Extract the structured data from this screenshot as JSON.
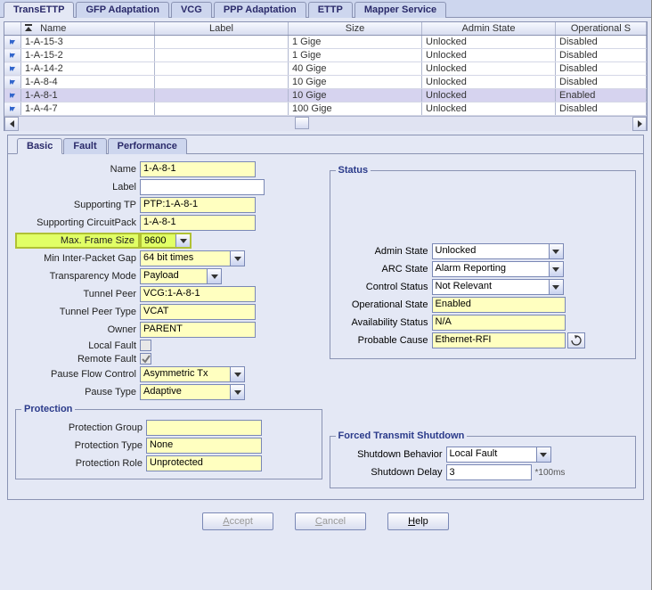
{
  "main_tabs": [
    "TransETTP",
    "GFP Adaptation",
    "VCG",
    "PPP Adaptation",
    "ETTP",
    "Mapper Service"
  ],
  "main_tab_active": 0,
  "table": {
    "cols": [
      "",
      "Name",
      "Label",
      "Size",
      "Admin State",
      "Operational S"
    ],
    "rows": [
      {
        "name": "1-A-15-3",
        "label": "",
        "size": "1 Gige",
        "admin": "Unlocked",
        "oper": "Disabled",
        "sel": false
      },
      {
        "name": "1-A-15-2",
        "label": "",
        "size": "1 Gige",
        "admin": "Unlocked",
        "oper": "Disabled",
        "sel": false
      },
      {
        "name": "1-A-14-2",
        "label": "",
        "size": "40 Gige",
        "admin": "Unlocked",
        "oper": "Disabled",
        "sel": false
      },
      {
        "name": "1-A-8-4",
        "label": "",
        "size": "10 Gige",
        "admin": "Unlocked",
        "oper": "Disabled",
        "sel": false
      },
      {
        "name": "1-A-8-1",
        "label": "",
        "size": "10 Gige",
        "admin": "Unlocked",
        "oper": "Enabled",
        "sel": true
      },
      {
        "name": "1-A-4-7",
        "label": "",
        "size": "100 Gige",
        "admin": "Unlocked",
        "oper": "Disabled",
        "sel": false
      }
    ]
  },
  "sub_tabs": [
    "Basic",
    "Fault",
    "Performance"
  ],
  "sub_tab_active": 0,
  "form": {
    "name": "1-A-8-1",
    "label": "",
    "supporting_tp": "PTP:1-A-8-1",
    "supporting_circuitpack": "1-A-8-1",
    "max_frame_size_lbl": "Max. Frame Size",
    "max_frame_size": "9600",
    "min_inter_packet_gap": "64 bit times",
    "transparency_mode": "Payload",
    "tunnel_peer": "VCG:1-A-8-1",
    "tunnel_peer_type": "VCAT",
    "owner": "PARENT",
    "local_fault": false,
    "remote_fault": true,
    "pause_flow_control": "Asymmetric Tx",
    "pause_type": "Adaptive",
    "lbl": {
      "name": "Name",
      "label": "Label",
      "supporting_tp": "Supporting TP",
      "supporting_circuitpack": "Supporting CircuitPack",
      "min_inter_packet_gap": "Min Inter-Packet Gap",
      "transparency_mode": "Transparency Mode",
      "tunnel_peer": "Tunnel Peer",
      "tunnel_peer_type": "Tunnel Peer Type",
      "owner": "Owner",
      "local_fault": "Local Fault",
      "remote_fault": "Remote Fault",
      "pause_flow_control": "Pause Flow Control",
      "pause_type": "Pause Type"
    }
  },
  "protection": {
    "legend": "Protection",
    "group": "",
    "type": "None",
    "role": "Unprotected",
    "lbl": {
      "group": "Protection Group",
      "type": "Protection Type",
      "role": "Protection Role"
    }
  },
  "status": {
    "legend": "Status",
    "admin_state": "Unlocked",
    "arc_state": "Alarm Reporting",
    "control_status": "Not Relevant",
    "operational_state": "Enabled",
    "availability_status": "N/A",
    "probable_cause": "Ethernet-RFI",
    "lbl": {
      "admin_state": "Admin State",
      "arc_state": "ARC State",
      "control_status": "Control Status",
      "operational_state": "Operational State",
      "availability_status": "Availability Status",
      "probable_cause": "Probable Cause"
    }
  },
  "shutdown": {
    "legend": "Forced Transmit Shutdown",
    "behavior": "Local Fault",
    "delay": "3",
    "delay_hint": "*100ms",
    "lbl": {
      "behavior": "Shutdown Behavior",
      "delay": "Shutdown Delay"
    }
  },
  "buttons": {
    "accept": "Accept",
    "cancel": "Cancel",
    "help": "Help"
  }
}
